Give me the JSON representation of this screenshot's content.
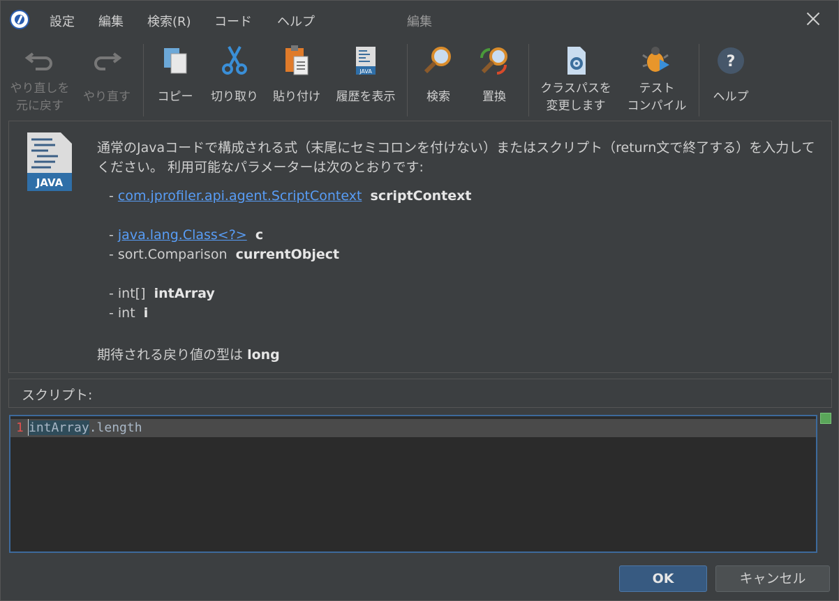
{
  "menu": {
    "items": [
      "設定",
      "編集",
      "検索(R)",
      "コード",
      "ヘルプ"
    ]
  },
  "window_title": "編集",
  "toolbar": {
    "undo": "やり直しを\n元に戻す",
    "redo": "やり直す",
    "copy": "コピー",
    "cut": "切り取り",
    "paste": "貼り付け",
    "history": "履歴を表示",
    "find": "検索",
    "replace": "置換",
    "classpath": "クラスパスを\n変更します",
    "test_compile": "テスト\nコンパイル",
    "help": "ヘルプ"
  },
  "description": {
    "icon_label": "JAVA",
    "intro": "通常のJavaコードで構成される式（末尾にセミコロンを付けない）またはスクリプト（return文で終了する）を入力してください。 利用可能なパラメーターは次のとおりです:",
    "params": [
      {
        "type": "com.jprofiler.api.agent.ScriptContext",
        "name": "scriptContext",
        "link": true
      },
      {
        "type": "java.lang.Class<?>",
        "name": "c",
        "link": true
      },
      {
        "type": "sort.Comparison",
        "name": "currentObject",
        "link": false
      },
      {
        "type": "int[]",
        "name": "intArray",
        "link": false
      },
      {
        "type": "int",
        "name": "i",
        "link": false
      }
    ],
    "return_prefix": "期待される戻り値の型は",
    "return_type": "long"
  },
  "script_label": "スクリプト:",
  "editor": {
    "line_number": "1",
    "code_highlight": "intArray",
    "code_rest": ".length"
  },
  "buttons": {
    "ok": "OK",
    "cancel": "キャンセル"
  }
}
